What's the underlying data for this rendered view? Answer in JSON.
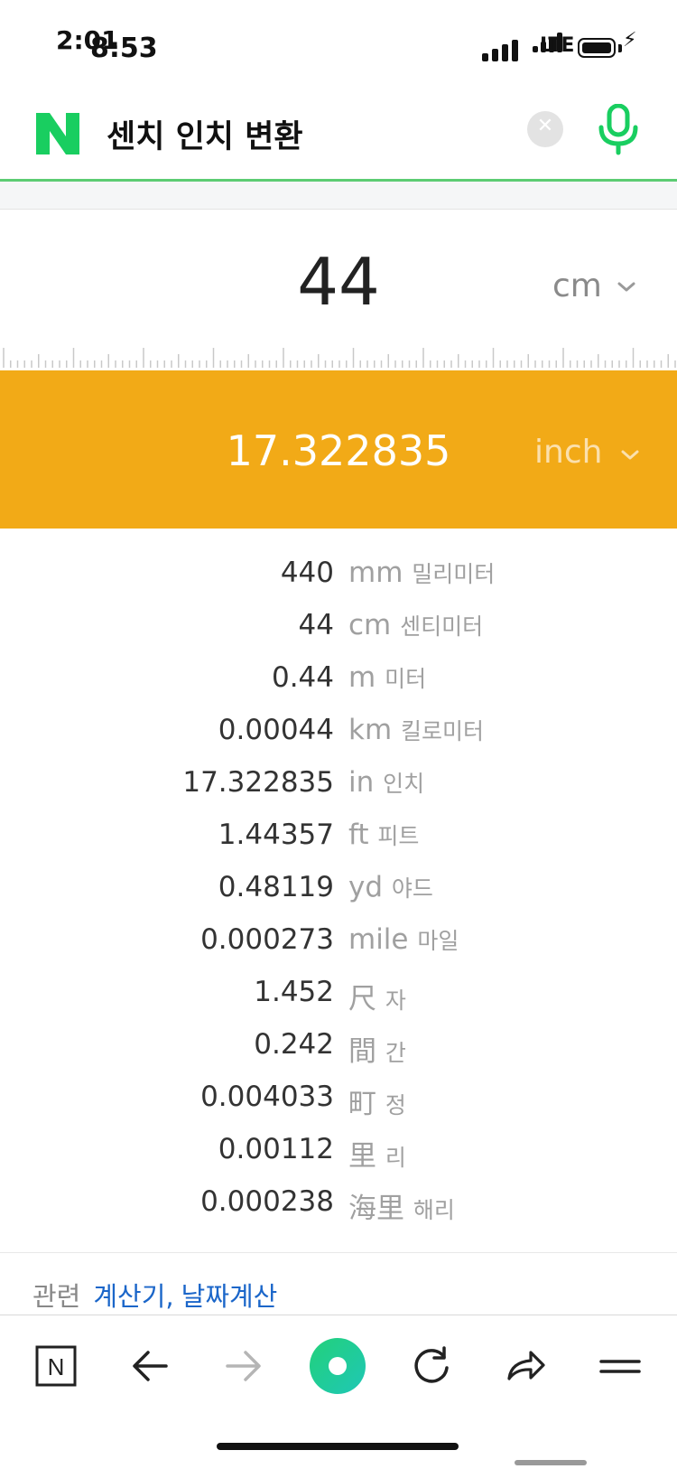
{
  "status_bar": {
    "time_overlay": "2:01",
    "time": "8:53",
    "network": "LTE"
  },
  "search": {
    "logo_letter": "N",
    "query": "센치 인치 변환",
    "clear_icon": "close-icon",
    "mic_icon": "microphone-icon",
    "accent_color": "#5ccc73"
  },
  "converter": {
    "input_value": "44",
    "input_unit": "cm",
    "output_value": "17.322835",
    "output_unit": "inch",
    "result_band_color": "#f2aa17"
  },
  "conversions": [
    {
      "value": "440",
      "unit": "mm",
      "unit_ko": "밀리미터"
    },
    {
      "value": "44",
      "unit": "cm",
      "unit_ko": "센티미터"
    },
    {
      "value": "0.44",
      "unit": "m",
      "unit_ko": "미터"
    },
    {
      "value": "0.00044",
      "unit": "km",
      "unit_ko": "킬로미터"
    },
    {
      "value": "17.322835",
      "unit": "in",
      "unit_ko": "인치"
    },
    {
      "value": "1.44357",
      "unit": "ft",
      "unit_ko": "피트"
    },
    {
      "value": "0.48119",
      "unit": "yd",
      "unit_ko": "야드"
    },
    {
      "value": "0.000273",
      "unit": "mile",
      "unit_ko": "마일"
    },
    {
      "value": "1.452",
      "unit": "尺",
      "unit_ko": "자"
    },
    {
      "value": "0.242",
      "unit": "間",
      "unit_ko": "간"
    },
    {
      "value": "0.004033",
      "unit": "町",
      "unit_ko": "정"
    },
    {
      "value": "0.00112",
      "unit": "里",
      "unit_ko": "리"
    },
    {
      "value": "0.000238",
      "unit": "海里",
      "unit_ko": "해리"
    }
  ],
  "related": {
    "label": "관련",
    "links": [
      "계산기",
      "날짜계산"
    ],
    "separator": ","
  },
  "browser_bar": {
    "home_icon_letter": "N",
    "icons": [
      "naver-home-icon",
      "back-arrow-icon",
      "forward-arrow-icon",
      "green-dot-menu-icon",
      "reload-icon",
      "share-icon",
      "menu-icon"
    ]
  }
}
